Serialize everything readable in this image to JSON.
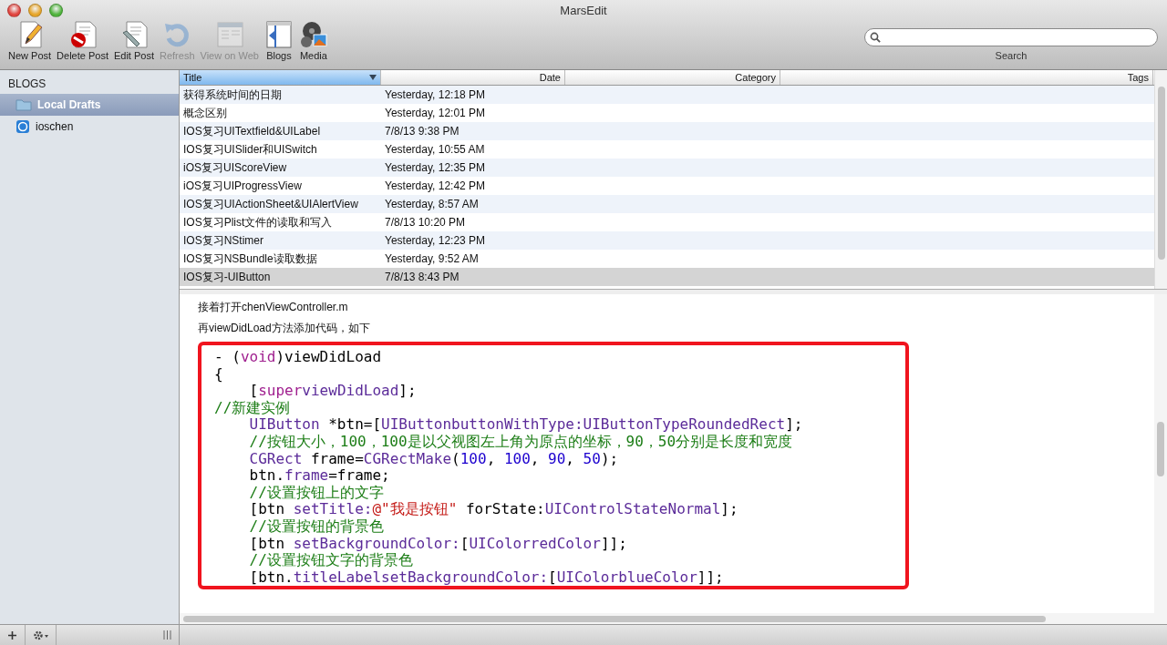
{
  "window": {
    "title": "MarsEdit"
  },
  "toolbar": [
    {
      "label": "New Post",
      "kind": "new",
      "disabled": false
    },
    {
      "label": "Delete Post",
      "kind": "delete",
      "disabled": false
    },
    {
      "label": "Edit Post",
      "kind": "edit",
      "disabled": false
    },
    {
      "label": "Refresh",
      "kind": "refresh",
      "disabled": true
    },
    {
      "label": "View on Web",
      "kind": "web",
      "disabled": true
    },
    {
      "label": "Blogs",
      "kind": "blogs",
      "disabled": false
    },
    {
      "label": "Media",
      "kind": "media",
      "disabled": false
    }
  ],
  "search": {
    "label": "Search"
  },
  "sidebar": {
    "heading": "BLOGS",
    "items": [
      {
        "label": "Local Drafts",
        "kind": "folder",
        "selected": true
      },
      {
        "label": "ioschen",
        "kind": "blog",
        "selected": false
      }
    ]
  },
  "table": {
    "columns": [
      {
        "label": "Title",
        "sorted": true
      },
      {
        "label": "Date",
        "sorted": false
      },
      {
        "label": "Category",
        "sorted": false
      },
      {
        "label": "Tags",
        "sorted": false
      }
    ],
    "rows": [
      {
        "title": "获得系统时间的日期",
        "date": "Yesterday, 12:18 PM",
        "selected": false
      },
      {
        "title": "概念区别",
        "date": "Yesterday, 12:01 PM",
        "selected": false
      },
      {
        "title": "IOS复习UITextfield&UILabel",
        "date": "7/8/13 9:38 PM",
        "selected": false
      },
      {
        "title": "IOS复习UISlider和UISwitch",
        "date": "Yesterday, 10:55 AM",
        "selected": false
      },
      {
        "title": "iOS复习UIScoreView",
        "date": "Yesterday, 12:35 PM",
        "selected": false
      },
      {
        "title": "iOS复习UIProgressView",
        "date": "Yesterday, 12:42 PM",
        "selected": false
      },
      {
        "title": "IOS复习UIActionSheet&UIAlertView",
        "date": "Yesterday, 8:57 AM",
        "selected": false
      },
      {
        "title": "IOS复习Plist文件的读取和写入",
        "date": "7/8/13 10:20 PM",
        "selected": false
      },
      {
        "title": "IOS复习NStimer",
        "date": "Yesterday, 12:23 PM",
        "selected": false
      },
      {
        "title": "IOS复习NSBundle读取数据",
        "date": "Yesterday, 9:52 AM",
        "selected": false
      },
      {
        "title": "IOS复习-UIButton",
        "date": "7/8/13 8:43 PM",
        "selected": true
      }
    ]
  },
  "preview": {
    "paragraphs": [
      "接着打开chenViewController.m",
      "再viewDidLoad方法添加代码，如下"
    ],
    "code": [
      [
        {
          "kind": "plain",
          "text": "- ("
        },
        {
          "kind": "keyword",
          "text": "void"
        },
        {
          "kind": "plain",
          "text": ")viewDidLoad"
        }
      ],
      [
        {
          "kind": "plain",
          "text": "{"
        }
      ],
      [
        {
          "kind": "plain",
          "text": "    ["
        },
        {
          "kind": "keyword",
          "text": "super"
        },
        {
          "kind": "type",
          "text": "viewDidLoad"
        },
        {
          "kind": "plain",
          "text": "];"
        }
      ],
      [
        {
          "kind": "comment",
          "text": "//新建实例"
        }
      ],
      [
        {
          "kind": "type",
          "text": "    UIButton"
        },
        {
          "kind": "plain",
          "text": " *btn=["
        },
        {
          "kind": "type",
          "text": "UIButtonbuttonWithType:UIButtonTypeRoundedRect"
        },
        {
          "kind": "plain",
          "text": "];"
        }
      ],
      [
        {
          "kind": "comment",
          "text": "    //按钮大小，100，100是以父视图左上角为原点的坐标，90，50分别是长度和宽度"
        }
      ],
      [
        {
          "kind": "type",
          "text": "    CGRect"
        },
        {
          "kind": "plain",
          "text": " frame="
        },
        {
          "kind": "type",
          "text": "CGRectMake"
        },
        {
          "kind": "plain",
          "text": "("
        },
        {
          "kind": "number",
          "text": "100"
        },
        {
          "kind": "plain",
          "text": ", "
        },
        {
          "kind": "number",
          "text": "100"
        },
        {
          "kind": "plain",
          "text": ", "
        },
        {
          "kind": "number",
          "text": "90"
        },
        {
          "kind": "plain",
          "text": ", "
        },
        {
          "kind": "number",
          "text": "50"
        },
        {
          "kind": "plain",
          "text": ");"
        }
      ],
      [
        {
          "kind": "plain",
          "text": "    btn."
        },
        {
          "kind": "type",
          "text": "frame"
        },
        {
          "kind": "plain",
          "text": "=frame;"
        }
      ],
      [
        {
          "kind": "comment",
          "text": "    //设置按钮上的文字"
        }
      ],
      [
        {
          "kind": "plain",
          "text": "    [btn "
        },
        {
          "kind": "type",
          "text": "setTitle:"
        },
        {
          "kind": "string",
          "text": "@\"我是按钮\""
        },
        {
          "kind": "plain",
          "text": " forState:"
        },
        {
          "kind": "type",
          "text": "UIControlStateNormal"
        },
        {
          "kind": "plain",
          "text": "];"
        }
      ],
      [
        {
          "kind": "comment",
          "text": "    //设置按钮的背景色"
        }
      ],
      [
        {
          "kind": "plain",
          "text": "    [btn "
        },
        {
          "kind": "type",
          "text": "setBackgroundColor:"
        },
        {
          "kind": "plain",
          "text": "["
        },
        {
          "kind": "type",
          "text": "UIColorredColor"
        },
        {
          "kind": "plain",
          "text": "]];"
        }
      ],
      [
        {
          "kind": "comment",
          "text": "    //设置按钮文字的背景色"
        }
      ],
      [
        {
          "kind": "plain",
          "text": "    [btn."
        },
        {
          "kind": "type",
          "text": "titleLabelsetBackgroundColor:"
        },
        {
          "kind": "plain",
          "text": "["
        },
        {
          "kind": "type",
          "text": "UIColorblueColor"
        },
        {
          "kind": "plain",
          "text": "]];"
        }
      ]
    ]
  }
}
